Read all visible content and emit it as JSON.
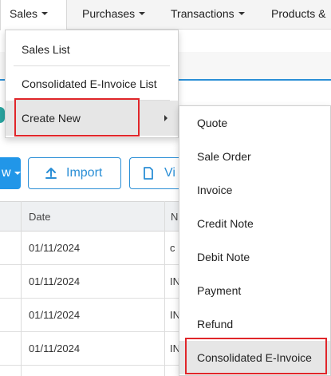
{
  "nav": {
    "sales": "Sales",
    "purchases": "Purchases",
    "transactions": "Transactions",
    "products": "Products &"
  },
  "toolbar": {
    "new_partial": "w",
    "import_label": "Import",
    "view_partial": "Vi"
  },
  "table": {
    "headers": {
      "date": "Date",
      "number_partial": "N"
    },
    "rows": [
      {
        "date": "01/11/2024",
        "number_partial": "c"
      },
      {
        "date": "01/11/2024",
        "number_partial": "IN"
      },
      {
        "date": "01/11/2024",
        "number_partial": "IN"
      },
      {
        "date": "01/11/2024",
        "number_partial": "IN"
      }
    ]
  },
  "sales_menu": {
    "items": [
      {
        "label": "Sales List"
      },
      {
        "label": "Consolidated E-Invoice List"
      },
      {
        "label": "Create New"
      }
    ]
  },
  "create_new_menu": {
    "items": [
      {
        "label": "Quote"
      },
      {
        "label": "Sale Order"
      },
      {
        "label": "Invoice"
      },
      {
        "label": "Credit Note"
      },
      {
        "label": "Debit Note"
      },
      {
        "label": "Payment"
      },
      {
        "label": "Refund"
      },
      {
        "label": "Consolidated E-Invoice"
      }
    ]
  },
  "colors": {
    "accent": "#2b8fd6",
    "highlight_border": "#e0262a",
    "menu_hover": "#e6e6e6"
  }
}
